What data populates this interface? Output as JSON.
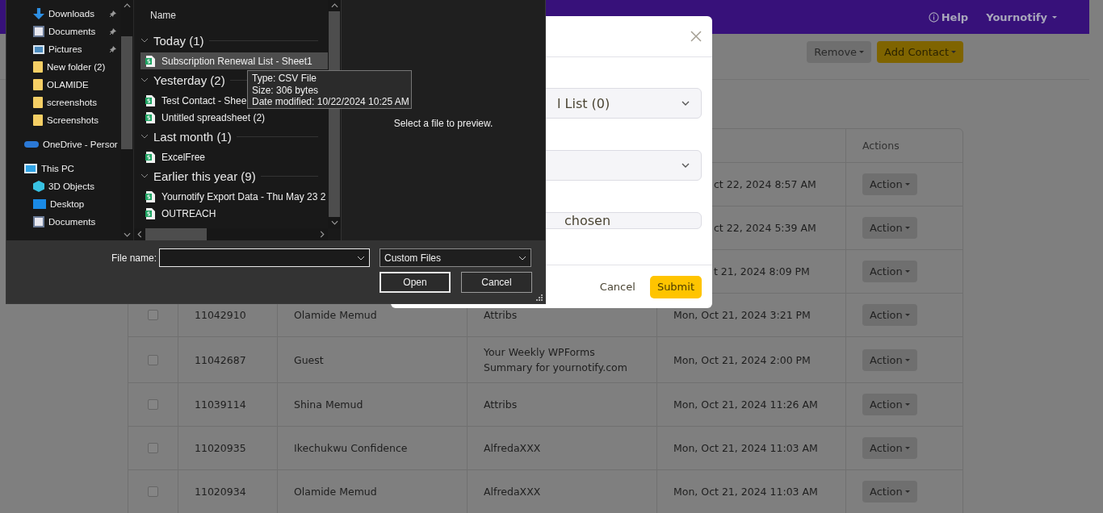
{
  "page": {
    "header": {
      "help": "Help",
      "account": "Yournotify"
    },
    "toolbar": [
      {
        "label": "Remove",
        "kind": "secondary"
      },
      {
        "label": "Add Contact",
        "kind": "primary"
      }
    ],
    "table": {
      "actions_heading": "Actions",
      "rows": [
        {
          "date": "ct 22, 2024 8:57 AM",
          "action": "Action"
        },
        {
          "date": "ct 22, 2024 5:39 AM",
          "action": "Action"
        },
        {
          "date": "t 21, 2024 8:09 PM",
          "action": "Action"
        },
        {
          "checked": false,
          "id": "11042910",
          "name": "Olamide Memud",
          "subject": "Attribs",
          "date": "Mon, Oct 21, 2024 3:21 PM",
          "action": "Action"
        },
        {
          "checked": false,
          "id": "11042687",
          "name": "Guest",
          "subject": "Your Weekly WPForms Summary for yournotify.com",
          "date": "Mon, Oct 21, 2024 2:00 PM",
          "action": "Action"
        },
        {
          "checked": false,
          "id": "11039114",
          "name": "Shina Memud",
          "subject": "Attribs",
          "date": "Mon, Oct 21, 2024 11:26 AM",
          "action": "Action"
        },
        {
          "checked": false,
          "id": "11020935",
          "name": "Ikechukwu Confidence",
          "subject": "AlfredaXXX",
          "date": "Mon, Oct 21, 2024 11:03 AM",
          "action": "Action"
        },
        {
          "checked": false,
          "id": "11020934",
          "name": "Olamide Memud",
          "subject": "AlfredaXXX",
          "date": "Mon, Oct 21, 2024 11:03 AM",
          "action": "Action"
        }
      ]
    }
  },
  "modal": {
    "list_select": "l List (0)",
    "file_field": "chosen",
    "cancel": "Cancel",
    "submit": "Submit"
  },
  "file_dialog": {
    "quick_access": [
      {
        "label": "Downloads",
        "kind": "downloads",
        "pinned": true
      },
      {
        "label": "Documents",
        "kind": "document",
        "pinned": true
      },
      {
        "label": "Pictures",
        "kind": "pictures",
        "pinned": true
      },
      {
        "label": "New folder (2)",
        "kind": "folder",
        "pinned": false
      },
      {
        "label": "OLAMIDE",
        "kind": "folder",
        "pinned": false
      },
      {
        "label": "screenshots",
        "kind": "folder",
        "pinned": false
      },
      {
        "label": "Screenshots",
        "kind": "folder",
        "pinned": false
      }
    ],
    "locations": [
      {
        "label": "OneDrive - Persor",
        "kind": "cloud"
      },
      {
        "label": "This PC",
        "kind": "pc",
        "children": [
          {
            "label": "3D Objects",
            "kind": "cube"
          },
          {
            "label": "Desktop",
            "kind": "desktop"
          },
          {
            "label": "Documents",
            "kind": "document"
          }
        ]
      }
    ],
    "column_header": "Name",
    "groups": [
      {
        "label": "Today (1)",
        "expanded": true,
        "files": [
          {
            "name": "Subscription Renewal List - Sheet1",
            "selected": true
          }
        ]
      },
      {
        "label": "Yesterday (2)",
        "expanded": true,
        "files": [
          {
            "name": "Test Contact - Shee",
            "selected": false
          },
          {
            "name": "Untitled spreadsheet (2)",
            "selected": false
          }
        ]
      },
      {
        "label": "Last month (1)",
        "expanded": true,
        "files": [
          {
            "name": "ExcelFree",
            "selected": false
          }
        ]
      },
      {
        "label": "Earlier this year (9)",
        "expanded": true,
        "files": [
          {
            "name": "Yournotify Export Data - Thu May 23 2",
            "selected": false
          },
          {
            "name": "OUTREACH",
            "selected": false
          }
        ]
      }
    ],
    "tooltip": [
      "Type: CSV File",
      "Size: 306 bytes",
      "Date modified: 10/22/2024 10:25 AM"
    ],
    "preview_text": "Select a file to preview.",
    "file_name_label": "File name:",
    "file_type": "Custom Files",
    "buttons": [
      "Open",
      "Cancel"
    ]
  }
}
